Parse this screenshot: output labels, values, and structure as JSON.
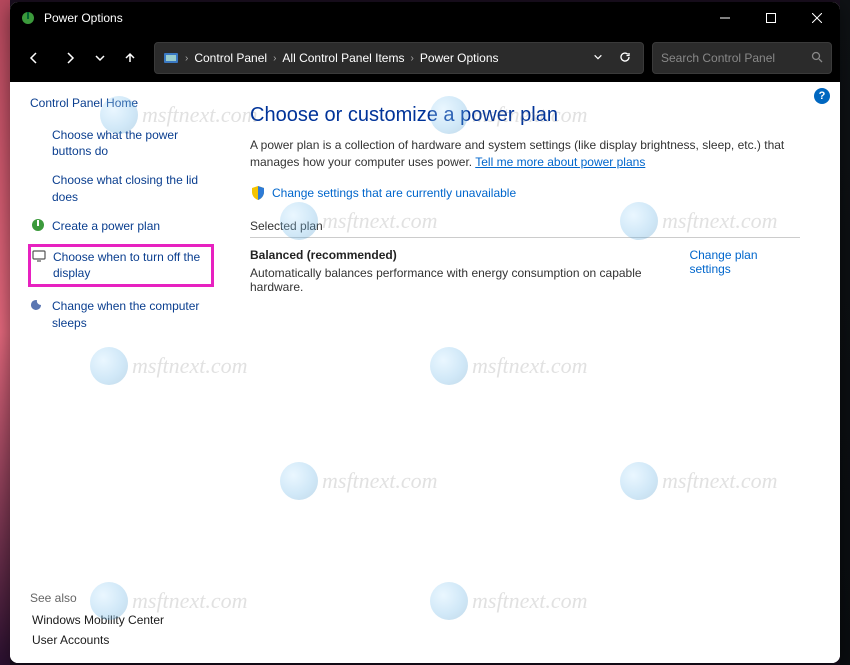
{
  "titlebar": {
    "title": "Power Options"
  },
  "breadcrumbs": {
    "item1": "Control Panel",
    "item2": "All Control Panel Items",
    "item3": "Power Options"
  },
  "search": {
    "placeholder": "Search Control Panel"
  },
  "sidebar": {
    "home": "Control Panel Home",
    "items": [
      {
        "label": "Choose what the power buttons do"
      },
      {
        "label": "Choose what closing the lid does"
      },
      {
        "label": "Create a power plan"
      },
      {
        "label": "Choose when to turn off the display"
      },
      {
        "label": "Change when the computer sleeps"
      }
    ],
    "see_also_title": "See also",
    "see_also": [
      {
        "label": "Windows Mobility Center"
      },
      {
        "label": "User Accounts"
      }
    ]
  },
  "main": {
    "heading": "Choose or customize a power plan",
    "description": "A power plan is a collection of hardware and system settings (like display brightness, sleep, etc.) that manages how your computer uses power. ",
    "learn_more": "Tell me more about power plans",
    "change_unavailable": "Change settings that are currently unavailable",
    "selected_plan_title": "Selected plan",
    "plan": {
      "name": "Balanced (recommended)",
      "desc": "Automatically balances performance with energy consumption on capable hardware.",
      "settings_link": "Change plan settings"
    }
  },
  "watermark": "msftnext.com"
}
